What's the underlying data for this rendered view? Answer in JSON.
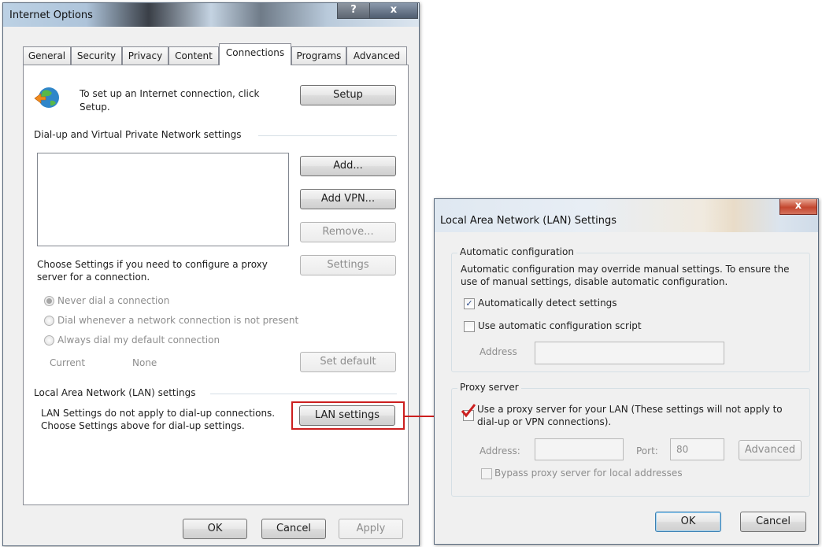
{
  "internet_options": {
    "title": "Internet Options",
    "help_label": "?",
    "close_label": "x",
    "tabs": [
      {
        "label": "General"
      },
      {
        "label": "Security"
      },
      {
        "label": "Privacy"
      },
      {
        "label": "Content"
      },
      {
        "label": "Connections"
      },
      {
        "label": "Programs"
      },
      {
        "label": "Advanced"
      }
    ],
    "active_tab": "Connections",
    "setup_text_line1": "To set up an Internet connection, click",
    "setup_text_line2": "Setup.",
    "setup_button": "Setup",
    "dialup_header": "Dial-up and Virtual Private Network settings",
    "add_button": "Add...",
    "add_vpn_button": "Add VPN...",
    "remove_button": "Remove...",
    "proxy_text_line1": "Choose Settings if you need to configure a proxy",
    "proxy_text_line2": "server for a connection.",
    "settings_button": "Settings",
    "radio_never": "Never dial a connection",
    "radio_whenever": "Dial whenever a network connection is not present",
    "radio_always": "Always dial my default connection",
    "current_label": "Current",
    "current_value": "None",
    "set_default_button": "Set default",
    "lan_header": "Local Area Network (LAN) settings",
    "lan_text_line1": "LAN Settings do not apply to dial-up connections.",
    "lan_text_line2": "Choose Settings above for dial-up settings.",
    "lan_settings_button": "LAN settings",
    "ok_button": "OK",
    "cancel_button": "Cancel",
    "apply_button": "Apply"
  },
  "lan_dialog": {
    "title": "Local Area Network (LAN) Settings",
    "close_label": "x",
    "auto_config_header": "Automatic configuration",
    "auto_config_text_line1": "Automatic configuration may override manual settings.  To ensure the",
    "auto_config_text_line2": "use of manual settings, disable automatic configuration.",
    "auto_detect_label": "Automatically detect settings",
    "auto_detect_checked": true,
    "use_script_label": "Use automatic configuration script",
    "use_script_checked": false,
    "address_label": "Address",
    "proxy_header": "Proxy server",
    "use_proxy_line1": "Use a proxy server for your LAN (These settings will not apply to",
    "use_proxy_line2": "dial-up or VPN connections).",
    "use_proxy_checked": true,
    "proxy_address_label": "Address:",
    "port_label": "Port:",
    "port_value": "80",
    "advanced_button": "Advanced",
    "bypass_label": "Bypass proxy server for local addresses",
    "ok_button": "OK",
    "cancel_button": "Cancel"
  },
  "colors": {
    "highlight": "#cc1f1f"
  }
}
